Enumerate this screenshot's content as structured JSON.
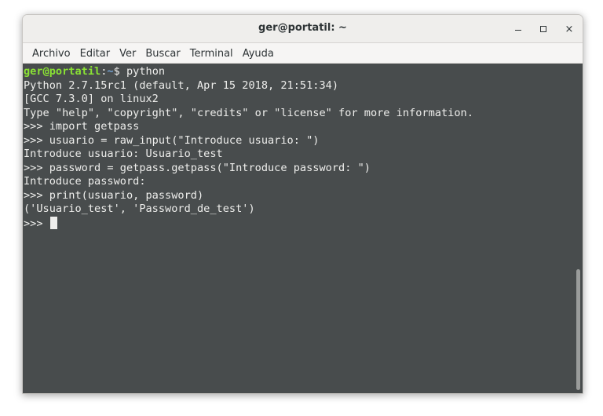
{
  "window": {
    "title": "ger@portatil: ~"
  },
  "titlebar_buttons": {
    "minimize_icon": "minimize-icon",
    "maximize_icon": "maximize-icon",
    "close_icon": "close-icon",
    "close_glyph": "×"
  },
  "menu": {
    "items": [
      "Archivo",
      "Editar",
      "Ver",
      "Buscar",
      "Terminal",
      "Ayuda"
    ]
  },
  "terminal": {
    "prompt": {
      "user_host": "ger@portatil",
      "colon": ":",
      "path": "~",
      "symbol": "$ ",
      "command": "python"
    },
    "lines": [
      "Python 2.7.15rc1 (default, Apr 15 2018, 21:51:34)",
      "[GCC 7.3.0] on linux2",
      "Type \"help\", \"copyright\", \"credits\" or \"license\" for more information.",
      ">>> import getpass",
      ">>> usuario = raw_input(\"Introduce usuario: \")",
      "Introduce usuario: Usuario_test",
      ">>> password = getpass.getpass(\"Introduce password: \")",
      "Introduce password:",
      ">>> print(usuario, password)",
      "('Usuario_test', 'Password_de_test')"
    ],
    "current_prompt": ">>> "
  },
  "colors": {
    "terminal_bg": "#484c4d",
    "terminal_fg": "#eeeeec",
    "prompt_user": "#8ae234",
    "prompt_path": "#729fcf"
  }
}
